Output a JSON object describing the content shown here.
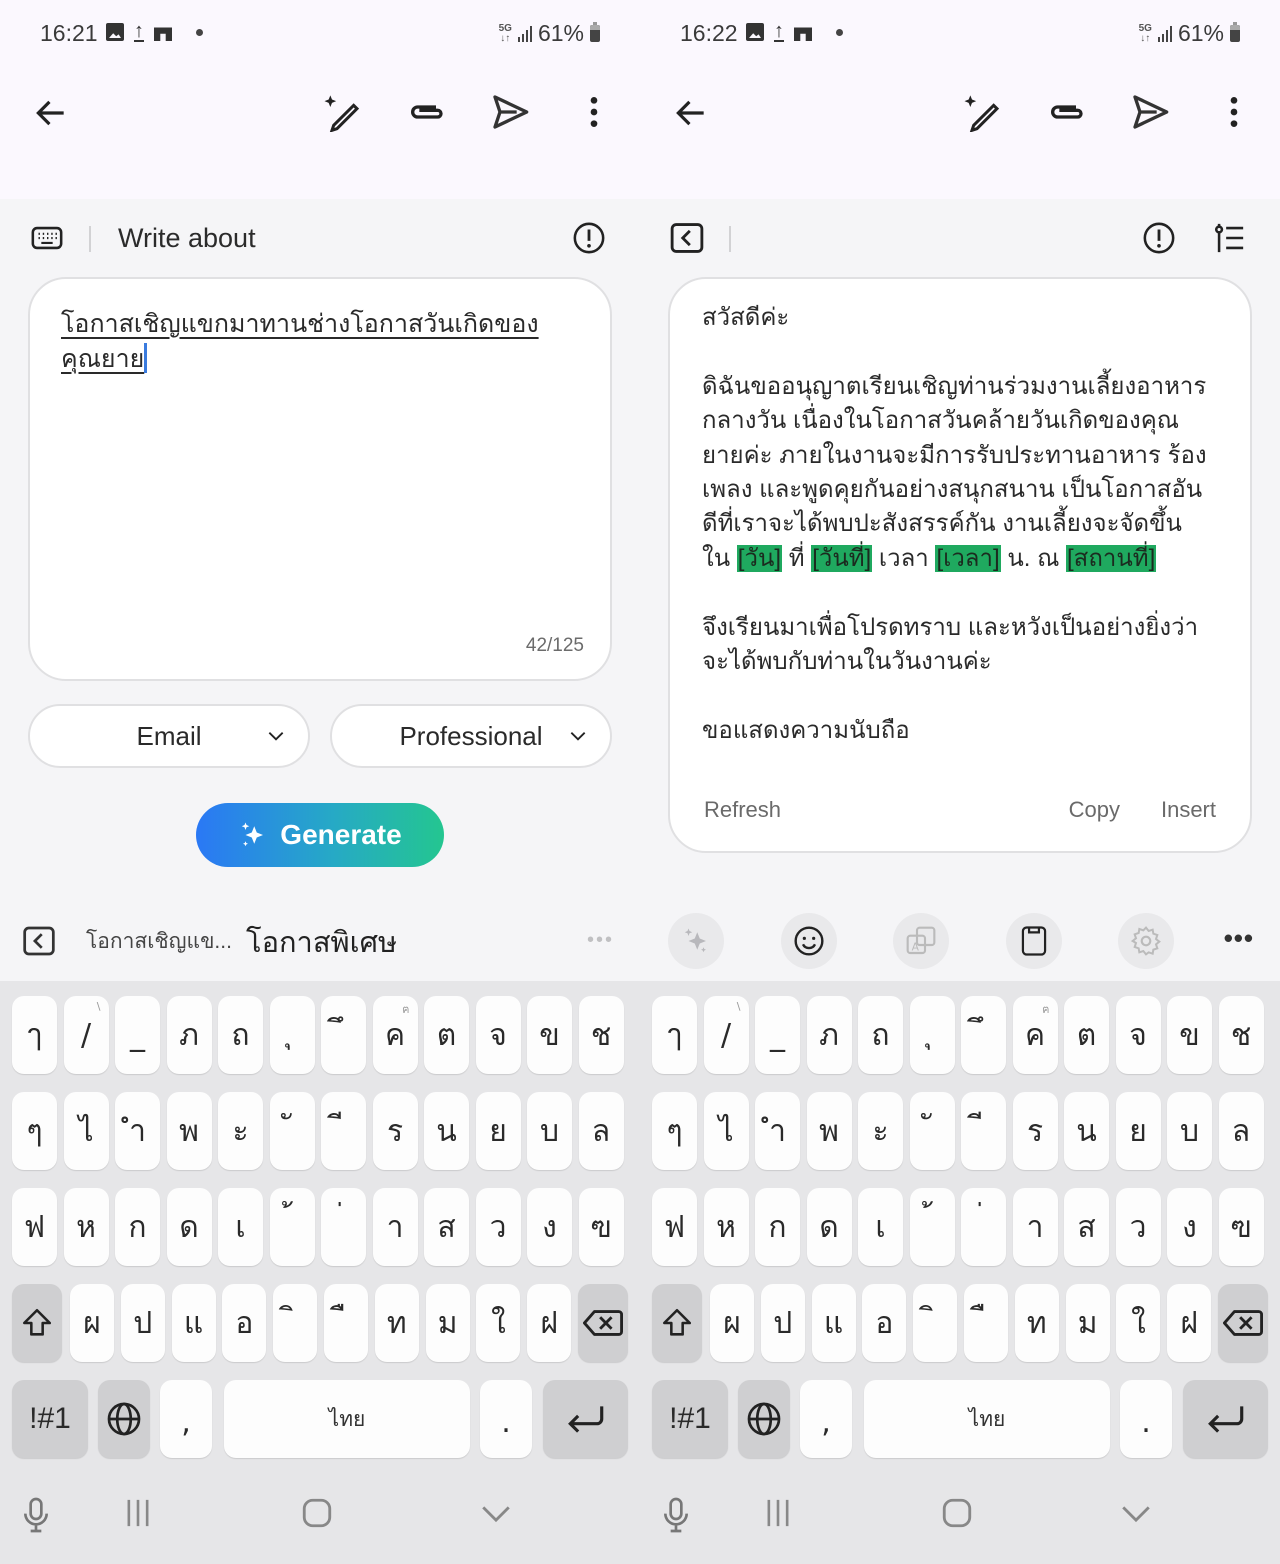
{
  "screens": [
    {
      "status": {
        "time": "16:21",
        "network": "5G",
        "battery": "61%"
      },
      "appbar": {
        "back": "back-arrow-icon",
        "actions": [
          "ai-pen-icon",
          "attach-icon",
          "send-icon",
          "more-vert-icon"
        ]
      },
      "toolbar": {
        "title": "Write about"
      },
      "input": {
        "value": "โอกาสเชิญแขกมาทานช่างโอกาสวันเกิดของคุณยาย",
        "counter": "42/125"
      },
      "dropdowns": [
        {
          "label": "Email"
        },
        {
          "label": "Professional"
        }
      ],
      "generate": {
        "label": "Generate"
      },
      "suggestions": {
        "items": [
          "โอกาสเชิญแข...",
          "โอกาสพิเศษ"
        ],
        "more": "•••"
      }
    },
    {
      "status": {
        "time": "16:22",
        "network": "5G",
        "battery": "61%"
      },
      "appbar": {
        "back": "back-arrow-icon",
        "actions": [
          "ai-pen-icon",
          "attach-icon",
          "send-icon",
          "more-vert-icon"
        ]
      },
      "result": {
        "greeting": "สวัสดีค่ะ",
        "body_lines": [
          "ดิฉันขออนุญาตเรียนเชิญท่านร่วมงานเลี้ยงอาหาร",
          "กลางวัน เนื่องในโอกาสวันคล้ายวันเกิดของคุณ",
          "ยายค่ะ ภายในงานจะมีการรับประทานอาหาร ร้อง",
          "เพลง และพูดคุยกันอย่างสนุกสนาน เป็นโอกาสอัน",
          "ดีที่เราจะได้พบปะสังสรรค์กัน งานเลี้ยงจะจัดขึ้น"
        ],
        "placeholder_line": {
          "prefix": "ใน",
          "day": "[วัน]",
          "t1": "ที่",
          "date": "[วันที่]",
          "t2": "เวลา",
          "time": "[เวลา]",
          "t3": "น. ณ",
          "place": "[สถานที่]"
        },
        "closing_lines": [
          "จึงเรียนมาเพื่อโปรดทราบ และหวังเป็นอย่างยิ่งว่า",
          "จะได้พบกับท่านในวันงานค่ะ"
        ],
        "signoff": "ขอแสดงความนับถือ",
        "actions": {
          "refresh": "Refresh",
          "copy": "Copy",
          "insert": "Insert"
        },
        "highlight_color": "#1fa95f"
      },
      "tools": [
        "ai-sparkle-icon",
        "emoji-icon",
        "translate-icon",
        "clipboard-icon",
        "settings-icon"
      ],
      "tools_more": "•••"
    }
  ],
  "keyboard": {
    "row1": [
      {
        "k": "ๅ"
      },
      {
        "k": "/",
        "hint": "\\"
      },
      {
        "k": "_"
      },
      {
        "k": "ภ"
      },
      {
        "k": "ถ"
      },
      {
        "k": "ุ"
      },
      {
        "k": "ึ"
      },
      {
        "k": "ค",
        "hint": "ฅ"
      },
      {
        "k": "ต"
      },
      {
        "k": "จ"
      },
      {
        "k": "ข"
      },
      {
        "k": "ช"
      }
    ],
    "row2": [
      {
        "k": "ๆ"
      },
      {
        "k": "ไ"
      },
      {
        "k": "ำ"
      },
      {
        "k": "พ"
      },
      {
        "k": "ะ"
      },
      {
        "k": "ั"
      },
      {
        "k": "ี"
      },
      {
        "k": "ร"
      },
      {
        "k": "น"
      },
      {
        "k": "ย"
      },
      {
        "k": "บ"
      },
      {
        "k": "ล"
      }
    ],
    "row3": [
      {
        "k": "ฟ"
      },
      {
        "k": "ห"
      },
      {
        "k": "ก"
      },
      {
        "k": "ด"
      },
      {
        "k": "เ"
      },
      {
        "k": "้"
      },
      {
        "k": "่"
      },
      {
        "k": "า"
      },
      {
        "k": "ส"
      },
      {
        "k": "ว"
      },
      {
        "k": "ง"
      },
      {
        "k": "ฃ"
      }
    ],
    "row4": [
      {
        "k": "ผ"
      },
      {
        "k": "ป"
      },
      {
        "k": "แ"
      },
      {
        "k": "อ"
      },
      {
        "k": "ิ"
      },
      {
        "k": "ื"
      },
      {
        "k": "ท"
      },
      {
        "k": "ม"
      },
      {
        "k": "ใ"
      },
      {
        "k": "ฝ"
      }
    ],
    "symbols_label": "!#1",
    "comma": ",",
    "space_label": "ไทย",
    "period": "."
  }
}
